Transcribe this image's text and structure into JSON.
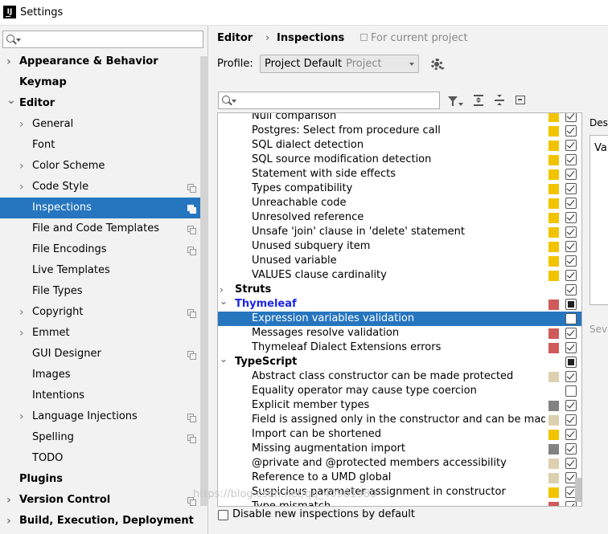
{
  "window": {
    "title": "Settings",
    "app_icon_text": "IJ"
  },
  "sidebar": {
    "search_placeholder": "",
    "items": [
      {
        "label": "Appearance & Behavior",
        "level": 0,
        "arrow": true,
        "bold": true
      },
      {
        "label": "Keymap",
        "level": 0,
        "arrow": false,
        "bold": true
      },
      {
        "label": "Editor",
        "level": 0,
        "arrow": "down",
        "bold": true
      },
      {
        "label": "General",
        "level": 1,
        "arrow": true
      },
      {
        "label": "Font",
        "level": 1,
        "arrow": false
      },
      {
        "label": "Color Scheme",
        "level": 1,
        "arrow": true
      },
      {
        "label": "Code Style",
        "level": 1,
        "arrow": true,
        "copy": true
      },
      {
        "label": "Inspections",
        "level": 1,
        "arrow": false,
        "copy": true,
        "selected": true
      },
      {
        "label": "File and Code Templates",
        "level": 1,
        "arrow": false,
        "copy": true
      },
      {
        "label": "File Encodings",
        "level": 1,
        "arrow": false,
        "copy": true
      },
      {
        "label": "Live Templates",
        "level": 1,
        "arrow": false
      },
      {
        "label": "File Types",
        "level": 1,
        "arrow": false
      },
      {
        "label": "Copyright",
        "level": 1,
        "arrow": true,
        "copy": true
      },
      {
        "label": "Emmet",
        "level": 1,
        "arrow": true
      },
      {
        "label": "GUI Designer",
        "level": 1,
        "arrow": false,
        "copy": true
      },
      {
        "label": "Images",
        "level": 1,
        "arrow": false
      },
      {
        "label": "Intentions",
        "level": 1,
        "arrow": false
      },
      {
        "label": "Language Injections",
        "level": 1,
        "arrow": true,
        "copy": true
      },
      {
        "label": "Spelling",
        "level": 1,
        "arrow": false,
        "copy": true
      },
      {
        "label": "TODO",
        "level": 1,
        "arrow": false
      },
      {
        "label": "Plugins",
        "level": 0,
        "arrow": false,
        "bold": true
      },
      {
        "label": "Version Control",
        "level": 0,
        "arrow": true,
        "bold": true,
        "copy": true
      },
      {
        "label": "Build, Execution, Deployment",
        "level": 0,
        "arrow": true,
        "bold": true
      }
    ]
  },
  "breadcrumb": {
    "parent": "Editor",
    "separator": "›",
    "current": "Inspections"
  },
  "scope_note": "For current project",
  "profile": {
    "label": "Profile:",
    "value": "Project Default",
    "scope": "Project"
  },
  "filter": {
    "placeholder": ""
  },
  "severity_colors": {
    "error": "#d05a5a",
    "warning": "#f2c400",
    "weak": "#ddd0b0",
    "info": "#828282"
  },
  "inspections": [
    {
      "label": "Null comparison",
      "level": 2,
      "sev": "warning",
      "check": "checked"
    },
    {
      "label": "Postgres: Select from procedure call",
      "level": 2,
      "sev": "warning",
      "check": "checked"
    },
    {
      "label": "SQL dialect detection",
      "level": 2,
      "sev": "warning",
      "check": "checked"
    },
    {
      "label": "SQL source modification detection",
      "level": 2,
      "sev": "warning",
      "check": "checked"
    },
    {
      "label": "Statement with side effects",
      "level": 2,
      "sev": "warning",
      "check": "checked"
    },
    {
      "label": "Types compatibility",
      "level": 2,
      "sev": "warning",
      "check": "checked"
    },
    {
      "label": "Unreachable code",
      "level": 2,
      "sev": "warning",
      "check": "checked"
    },
    {
      "label": "Unresolved reference",
      "level": 2,
      "sev": "warning",
      "check": "checked"
    },
    {
      "label": "Unsafe 'join' clause in 'delete' statement",
      "level": 2,
      "sev": "warning",
      "check": "checked"
    },
    {
      "label": "Unused subquery item",
      "level": 2,
      "sev": "warning",
      "check": "checked"
    },
    {
      "label": "Unused variable",
      "level": 2,
      "sev": "warning",
      "check": "checked"
    },
    {
      "label": "VALUES clause cardinality",
      "level": 2,
      "sev": "warning",
      "check": "checked"
    },
    {
      "label": "Struts",
      "level": 1,
      "group": true,
      "arrow": "right",
      "sev": "",
      "check": "checked"
    },
    {
      "label": "Thymeleaf",
      "level": 1,
      "group": true,
      "blue": true,
      "arrow": "down",
      "sev": "error",
      "check": "partial"
    },
    {
      "label": "Expression variables validation",
      "level": 2,
      "sev": "",
      "check": "unchecked",
      "selected": true
    },
    {
      "label": "Messages resolve validation",
      "level": 2,
      "sev": "error",
      "check": "checked"
    },
    {
      "label": "Thymeleaf Dialect Extensions errors",
      "level": 2,
      "sev": "error",
      "check": "checked"
    },
    {
      "label": "TypeScript",
      "level": 1,
      "group": true,
      "arrow": "down",
      "sev": "",
      "check": "partial"
    },
    {
      "label": "Abstract class constructor can be made protected",
      "level": 2,
      "sev": "weak",
      "check": "checked"
    },
    {
      "label": "Equality operator may cause type coercion",
      "level": 2,
      "sev": "",
      "check": "unchecked"
    },
    {
      "label": "Explicit member types",
      "level": 2,
      "sev": "info",
      "check": "checked"
    },
    {
      "label": "Field is assigned only in the constructor and can be made re",
      "level": 2,
      "sev": "weak",
      "check": "checked"
    },
    {
      "label": "Import can be shortened",
      "level": 2,
      "sev": "warning",
      "check": "checked"
    },
    {
      "label": "Missing augmentation import",
      "level": 2,
      "sev": "info",
      "check": "checked"
    },
    {
      "label": "@private and @protected members accessibility",
      "level": 2,
      "sev": "weak",
      "check": "checked"
    },
    {
      "label": "Reference to a UMD global",
      "level": 2,
      "sev": "weak",
      "check": "checked"
    },
    {
      "label": "Suspicious parameter assignment in constructor",
      "level": 2,
      "sev": "warning",
      "check": "checked"
    },
    {
      "label": "Type mismatch",
      "level": 2,
      "sev": "error",
      "check": "checked"
    }
  ],
  "disable_new": {
    "label": "Disable new inspections by default",
    "checked": false
  },
  "description": {
    "label": "Desc",
    "text": "Va"
  },
  "severity_label": "Sev",
  "watermark": "https://blog.csdn.net/qq_40961980"
}
